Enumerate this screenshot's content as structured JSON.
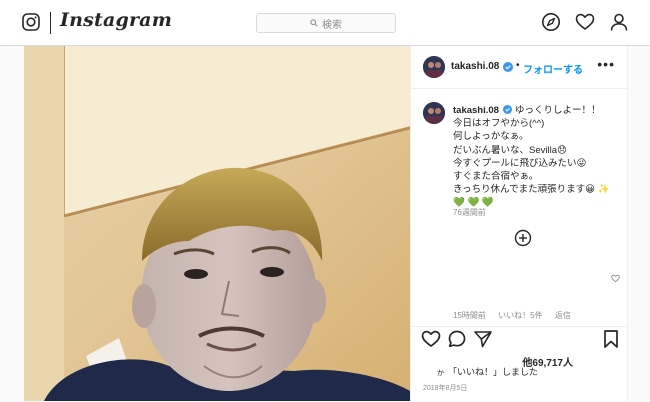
{
  "app": {
    "name": "Instagram"
  },
  "search": {
    "placeholder": "検索"
  },
  "nav": {
    "icons": [
      "explore-icon",
      "activity-heart-icon",
      "profile-icon"
    ]
  },
  "post": {
    "username": "takashi.08",
    "follow_label": "フォローする",
    "more_label": "•••",
    "caption_lines": [
      "ゆっくりしよー！！",
      "今日はオフやから(^^)",
      "何しよっかなぁ。",
      "だいぶん暑いな、Sevilla😞",
      "今すぐプールに飛び込みたい😜",
      "すぐまた合宿やぁ。",
      "きっちり休んでまた頑張ります😀 ✨",
      "💚 💚 💚"
    ],
    "caption_age": "76週間前",
    "comment_meta": {
      "age": "15時間前",
      "likes": "いいね！5件",
      "reply": "返信"
    },
    "like_count": "他69,717人",
    "liked_by_prefix": "か",
    "liked_by_text": "「いいね！」しました",
    "date": "2018年8月5日"
  },
  "colors": {
    "accent": "#0095f6",
    "text": "#262626",
    "muted": "#8e8e8e",
    "border": "#dbdbdb"
  }
}
